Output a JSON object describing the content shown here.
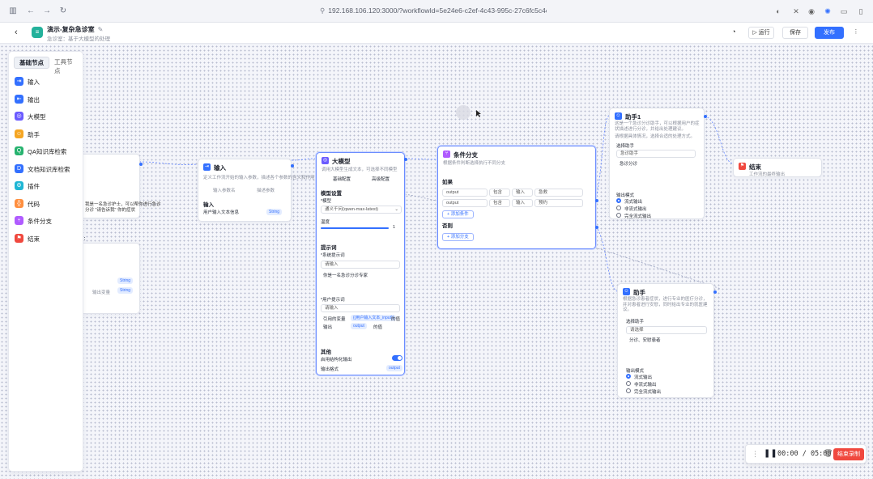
{
  "browser": {
    "url": "192.168.106.120:3000/?workflowId=5e24e6-c2ef-4c43-995c-27c6fc5c4c02",
    "back": "←",
    "forward": "→",
    "reload": "↻"
  },
  "header": {
    "title": "演示-复杂急诊室",
    "edit_icon": "✎",
    "subtitle": "急诊室：基于大模型的处理",
    "back_icon": "‹",
    "run_label": "运行",
    "save_label": "保存",
    "publish_label": "发布"
  },
  "panel": {
    "tabs": [
      "基础节点",
      "工具节点"
    ],
    "items": [
      {
        "label": "输入",
        "color": "#3370ff",
        "icon": "⇥"
      },
      {
        "label": "输出",
        "color": "#3370ff",
        "icon": "⇤"
      },
      {
        "label": "大模型",
        "color": "#6b5bff",
        "icon": "◎"
      },
      {
        "label": "助手",
        "color": "#f5a623",
        "icon": "☺"
      },
      {
        "label": "QA知识库检索",
        "color": "#27b36f",
        "icon": "Q"
      },
      {
        "label": "文档知识库检索",
        "color": "#3370ff",
        "icon": "D"
      },
      {
        "label": "插件",
        "color": "#1fb6d4",
        "icon": "⚙"
      },
      {
        "label": "代码",
        "color": "#ff8f3f",
        "icon": "{}"
      },
      {
        "label": "条件分支",
        "color": "#b05bff",
        "icon": "⑂"
      },
      {
        "label": "结束",
        "color": "#f0483e",
        "icon": "⚑"
      }
    ]
  },
  "nodes": {
    "input": {
      "title": "输入",
      "desc": "定义工作流开始的输入参数，描述各个参数的含义和作用",
      "tab1": "输入参数名",
      "tab2": "描述参数",
      "section": "输入",
      "param": "用户输入文本信息",
      "pill": "String"
    },
    "llm": {
      "title": "大模型",
      "desc": "调用大模型生成文本，可选择不同模型",
      "tab1": "基础配置",
      "tab2": "高级配置",
      "model_section": "模型设置",
      "model_label": "*模型",
      "model_value": "通义千问(qwen-max-latest)",
      "temp_label": "温度",
      "temp_value": "1",
      "prompt_section": "提示词",
      "sys_label": "*系统提示词",
      "sys_placeholder": "请输入",
      "sys_text": "你是一名急诊分诊专家",
      "user_label": "*用户提示词",
      "user_placeholder": "请输入",
      "ref_label": "引用的变量",
      "ref_pill": "{{用户输入文本_input}}",
      "ref_tail": "的值",
      "out_label": "输出",
      "out_pill": "output",
      "out_tail": "的值",
      "other_section": "其他",
      "toggle_label": "启用结构化输出",
      "format_label": "输出格式",
      "format_pill": "output"
    },
    "branch": {
      "title": "条件分支",
      "desc": "根据条件判断选择执行不同分支",
      "if_label": "如果",
      "rows": [
        {
          "var": "output",
          "op": "包含",
          "type": "输入",
          "val": "急救"
        },
        {
          "var": "output",
          "op": "包含",
          "type": "输入",
          "val": "预约"
        }
      ],
      "add_cond": "+ 添加条件",
      "else_label": "否则",
      "add_branch": "+ 添加分支"
    },
    "assistant1": {
      "title": "助手1",
      "desc": "这是一个急诊分诊助手，可以根据用户的症状描述进行分诊，并给出处理建议。",
      "desc2": "请根据具体情况，选择合适的处理方式。",
      "section": "选择助手",
      "field": "急诊助手",
      "item": "急诊分诊",
      "mode_label": "输出模式",
      "modes": [
        "流式输出",
        "非流式输出",
        "完全流式输出"
      ]
    },
    "assistant2": {
      "title": "助手",
      "desc": "根据急诊患者症状，进行专业的医疗分诊，并对患者进行安慰，同时给出专业的就医建议。",
      "section": "选择助手",
      "field": "请选择",
      "text": "分诊、安慰患者",
      "mode_label": "输出模式",
      "modes": [
        "流式输出",
        "非流式输出",
        "完全流式输出"
      ]
    },
    "end": {
      "title": "结束",
      "desc": "工作流的最终输出"
    },
    "left_partial": {
      "text1": "我是一名急诊护士，可以帮你进行急诊",
      "text2": "分诊 \"请告诉我\" 你的症状",
      "text3": "：",
      "pill1": "String",
      "pill2": "String",
      "row": "输出变量"
    }
  },
  "recorder": {
    "time": "00:00 / 05:00",
    "end_label": "结束录制"
  }
}
